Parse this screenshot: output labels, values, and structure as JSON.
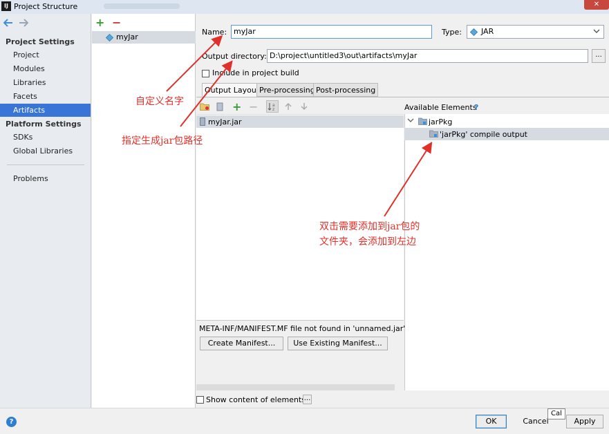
{
  "window": {
    "title": "Project Structure",
    "app_icon": "IJ",
    "close_icon": "close-x"
  },
  "sidebar": {
    "project_settings_header": "Project Settings",
    "project_items": [
      {
        "label": "Project"
      },
      {
        "label": "Modules"
      },
      {
        "label": "Libraries"
      },
      {
        "label": "Facets"
      },
      {
        "label": "Artifacts",
        "selected": true
      }
    ],
    "platform_settings_header": "Platform Settings",
    "platform_items": [
      {
        "label": "SDKs"
      },
      {
        "label": "Global Libraries"
      }
    ],
    "problems_label": "Problems"
  },
  "artifacts": {
    "add_icon": "+",
    "remove_icon": "−",
    "items": [
      {
        "label": "myJar",
        "selected": true
      }
    ]
  },
  "form": {
    "name_label": "Name:",
    "name_value": "myJar",
    "type_label": "Type:",
    "type_value": "JAR",
    "output_dir_label": "Output directory:",
    "output_dir_value": "D:\\project\\untitled3\\out\\artifacts\\myJar",
    "browse_label": "...",
    "include_in_build_label": "Include in project build",
    "include_in_build_checked": false
  },
  "tabs": [
    {
      "label": "Output Layout",
      "active": true
    },
    {
      "label": "Pre-processing",
      "active": false
    },
    {
      "label": "Post-processing",
      "active": false
    }
  ],
  "layout_tree": {
    "items": [
      {
        "label": "myJar.jar",
        "selected": true
      }
    ]
  },
  "available_elements": {
    "title": "Available Elements",
    "help": "?",
    "tree": [
      {
        "label": "jarPkg",
        "expanded": true
      },
      {
        "label": "'jarPkg' compile output",
        "selected": true
      }
    ]
  },
  "manifest": {
    "message": "META-INF/MANIFEST.MF file not found in 'unnamed.jar'",
    "create_button": "Create Manifest...",
    "use_existing_button": "Use Existing Manifest..."
  },
  "show_content": {
    "label": "Show content of elements",
    "checked": false,
    "button": "..."
  },
  "footer": {
    "ok_label": "OK",
    "cancel_label": "Cancel",
    "apply_label": "Apply",
    "cancel_tooltip": "Cal",
    "help_label": "?"
  },
  "annotations": {
    "custom_name": "自定义名字",
    "jar_path": "指定生成jar包路径",
    "double_click_line1": "双击需要添加到jar包的",
    "double_click_line2": "文件夹，会添加到左边",
    "color": "#e0302a"
  },
  "colors": {
    "selection": "#3875d7",
    "annotation": "#e0302a",
    "titlebar": "#dde6f1"
  }
}
